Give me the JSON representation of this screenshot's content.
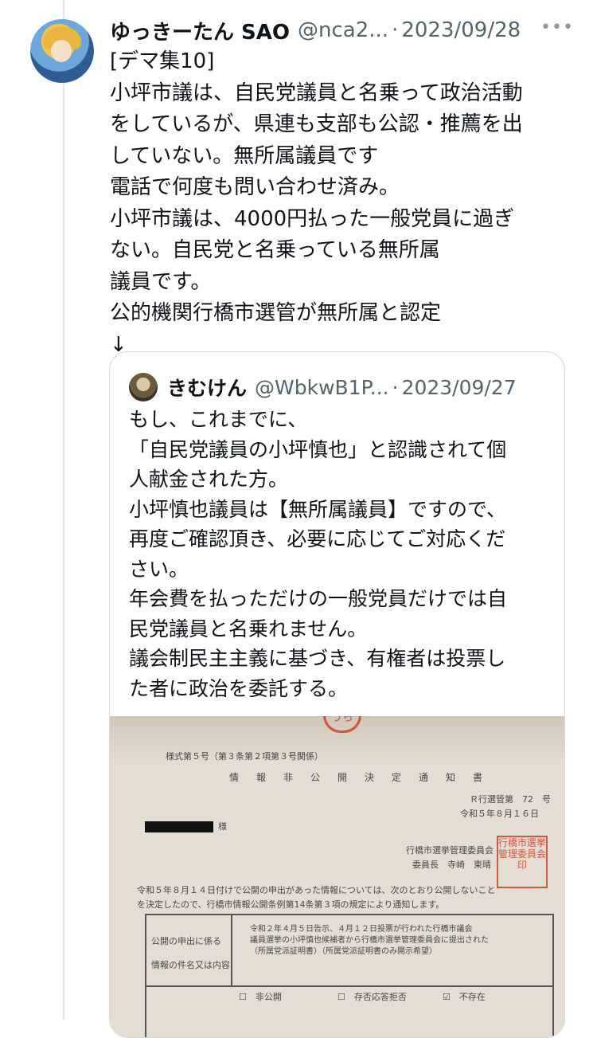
{
  "tweet": {
    "author_name": "ゆっきーたん SAO",
    "handle": "@nca2...",
    "separator": "·",
    "date": "2023/09/28",
    "more_icon": "ellipsis-icon",
    "lines": [
      "[デマ集10]",
      "小坪市議は、自民党議員と名乗って政治活動",
      "をしているが、県連も支部も公認・推薦を出",
      "していない。無所属議員です",
      "電話で何度も問い合わせ済み。",
      "小坪市議は、4000円払った一般党員に過ぎ",
      "ない。自民党と名乗っている無所属",
      "議員です。",
      "公的機関行橋市選管が無所属と認定",
      "↓"
    ]
  },
  "quote": {
    "author_name": "きむけん",
    "handle": "@WbkwB1P...",
    "separator": "·",
    "date": "2023/09/27",
    "lines": [
      "もし、これまでに、",
      "「自民党議員の小坪慎也」と認識されて個",
      "人献金された方。",
      "小坪慎也議員は【無所属議員】ですので、",
      "再度ご確認頂き、必要に応じてご対応くだ",
      "さい。",
      "年会費を払っただけの一般党員だけでは自",
      "民党議員と名乗れません。",
      "議会制民主主義に基づき、有権者は投票し",
      "た者に政治を委託する。"
    ],
    "document": {
      "form": "様式第５号（第３条第２項第３号関係）",
      "title": "情報非公開決定通知書",
      "number": "Ｒ行選管第　72　号",
      "date": "令和５年８月１６日",
      "honorific": "様",
      "committee": "行橋市選挙管理委員会",
      "chair": "委員長　寺崎　東晴",
      "seal": "行橋市選挙管理委員会印",
      "body1": "令和５年８月１４日付けで公開の申出があった情報については、次のとおり公開しないこと",
      "body2": "を決定したので、行橋市情報公開条例第14条第３項の規定により通知します。",
      "row_label1": "公開の申出に係る",
      "row_label2": "情報の件名又は内容",
      "content1": "令和２年４月５日告示、４月１２日投票が行われた行橋市議会",
      "content2": "議員選挙の小坪慎也候補者から行橋市選挙管理委員会に提出された",
      "content3": "（所属党派証明書）（所属党派証明書のみ開示希望）",
      "check1": "☐　非公開",
      "check2": "☐　存否応答拒否",
      "check3": "☑　不存在"
    }
  }
}
